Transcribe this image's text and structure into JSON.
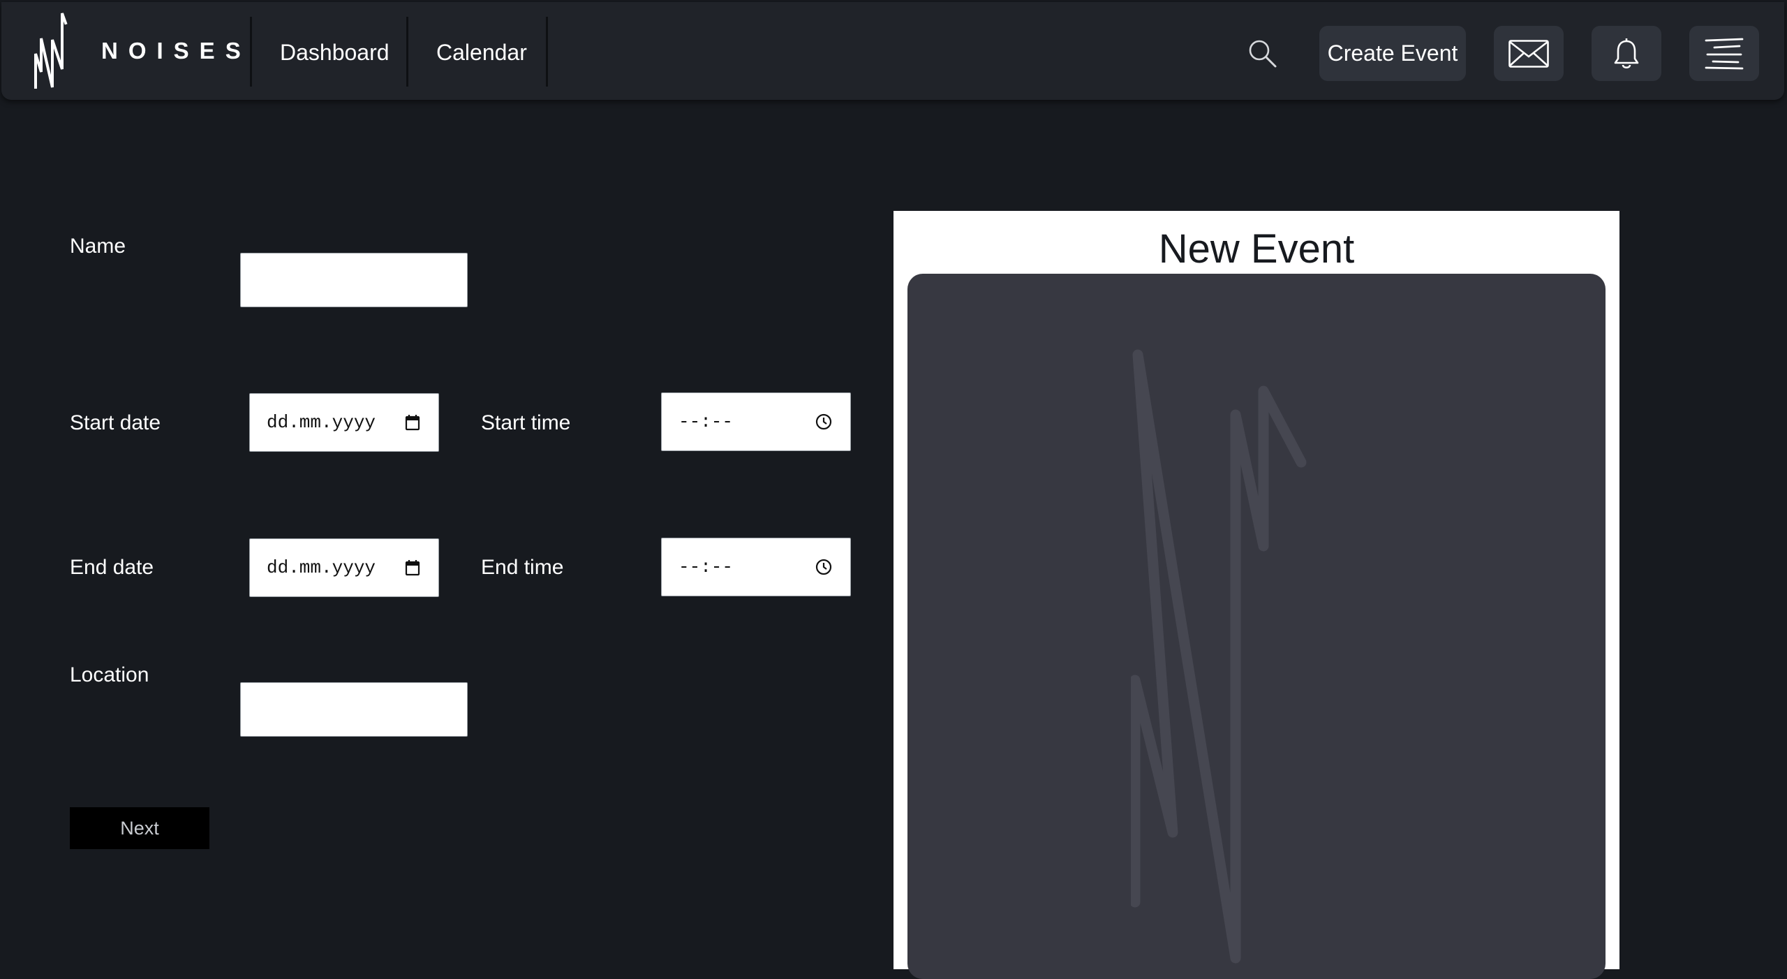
{
  "header": {
    "brand": "NOISES",
    "nav": {
      "dashboard": "Dashboard",
      "calendar": "Calendar"
    },
    "create_event_label": "Create Event",
    "icons": [
      "logo-icon",
      "search-icon",
      "mail-icon",
      "bell-icon",
      "menu-icon"
    ]
  },
  "form": {
    "name_label": "Name",
    "name_value": "",
    "start_date_label": "Start date",
    "start_date_placeholder": "dd.mm.yyyy",
    "start_time_label": "Start time",
    "start_time_placeholder": "--:--",
    "end_date_label": "End date",
    "end_date_placeholder": "dd.mm.yyyy",
    "end_time_label": "End time",
    "end_time_placeholder": "--:--",
    "location_label": "Location",
    "location_value": "",
    "next_label": "Next"
  },
  "preview": {
    "title": "New Event"
  },
  "colors": {
    "page_background": "#171a1f",
    "header_background": "#202329",
    "button_background": "#2f333b",
    "preview_placeholder": "#373841",
    "next_button": "#000000"
  }
}
